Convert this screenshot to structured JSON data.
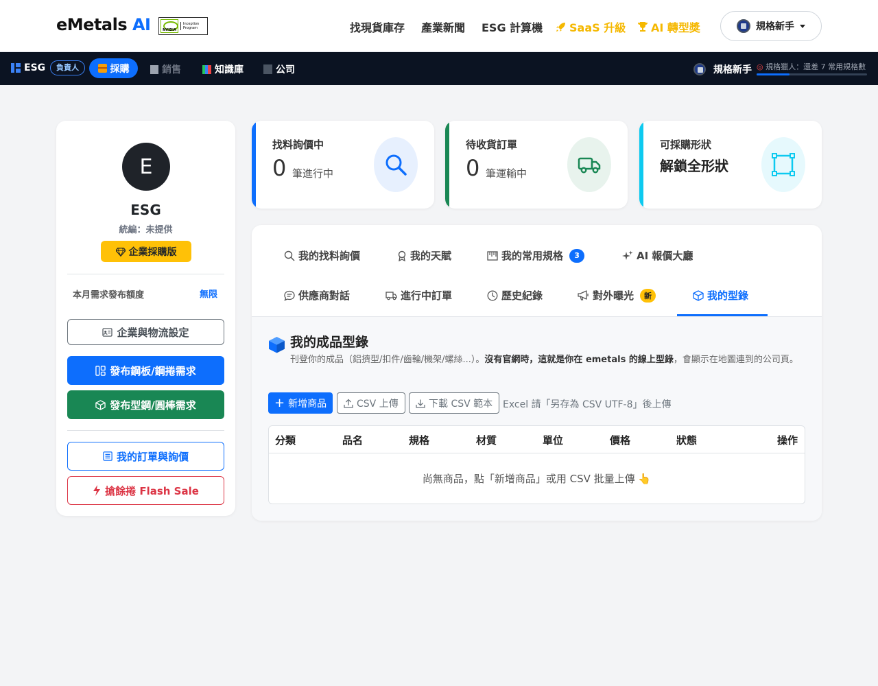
{
  "brand": {
    "name": "eMetals",
    "ai": "AI",
    "partner_line1": "Inception",
    "partner_line2": "Program",
    "partner_logo": "NVIDIA"
  },
  "topnav": {
    "items": [
      "找現貨庫存",
      "產業新聞",
      "ESG 計算機",
      "SaaS 升級",
      "AI 轉型獎"
    ],
    "user_label": "規格新手"
  },
  "subnav": {
    "company": "ESG",
    "role": "負責人",
    "tabs": [
      "採購",
      "銷售",
      "知識庫",
      "公司"
    ],
    "user_label": "規格新手",
    "progress_text": "規格獵人：還差 7 常用規格數",
    "progress_fraction": 0.3
  },
  "profile": {
    "avatar_letter": "E",
    "name": "ESG",
    "tax_id": "統編：未提供",
    "tier": "企業採購版",
    "quota_label": "本月需求發布額度",
    "quota_value": "無限",
    "buttons": {
      "settings": "企業與物流設定",
      "post_plate": "發布鋼板/鋼捲需求",
      "post_section": "發布型鋼/圓棒需求",
      "orders": "我的訂單與詢價",
      "flash": "搶餘捲 Flash Sale"
    }
  },
  "stats": [
    {
      "label": "找料詢價中",
      "value": "0",
      "unit": "筆進行中",
      "color": "#0d6efd",
      "icon": "search-icon"
    },
    {
      "label": "待收貨訂單",
      "value": "0",
      "unit": "筆運輸中",
      "color": "#198754",
      "icon": "truck-icon"
    },
    {
      "label": "可採購形狀",
      "value": "解鎖全形狀",
      "color": "#0dcaf0",
      "icon": "bounding-box-icon"
    }
  ],
  "tabs": {
    "row1": [
      "我的找料詢價",
      "我的天賦",
      "我的常用規格",
      "AI 報價大廳"
    ],
    "row2": [
      "供應商對話",
      "進行中訂單",
      "歷史紀錄",
      "對外曝光",
      "我的型錄"
    ],
    "specs_count": "3",
    "new_badge": "新"
  },
  "catalog": {
    "title": "我的成品型錄",
    "desc_prefix": "刊登你的成品（鋁擠型/扣件/齒輪/機架/螺絲...）。",
    "desc_bold": "沒有官網時，這就是你在 emetals 的線上型錄",
    "desc_suffix": "，會顯示在地圖連到的公司頁。",
    "add_button": "新增商品",
    "upload_button": "CSV 上傳",
    "download_button": "下載 CSV 範本",
    "hint": "Excel 請「另存為 CSV UTF-8」後上傳",
    "columns": [
      "分類",
      "品名",
      "規格",
      "材質",
      "單位",
      "價格",
      "狀態",
      "操作"
    ],
    "empty_text": "尚無商品，點「新增商品」或用 CSV 批量上傳 👆"
  }
}
